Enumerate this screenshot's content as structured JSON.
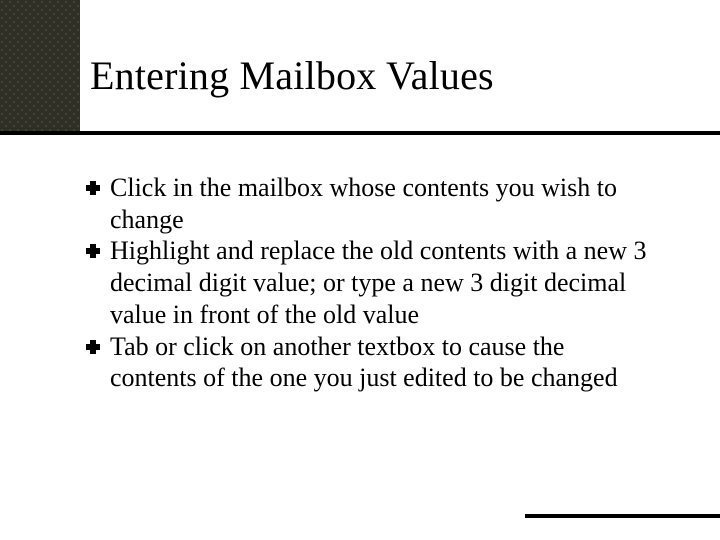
{
  "title": "Entering Mailbox Values",
  "bullets": [
    "Click in the mailbox whose contents you wish to change",
    "Highlight and replace the old contents with a new 3 decimal digit value; or type a new 3 digit decimal value in front of the old value",
    "Tab or click on another textbox to cause the contents of the one you just edited to be changed"
  ]
}
